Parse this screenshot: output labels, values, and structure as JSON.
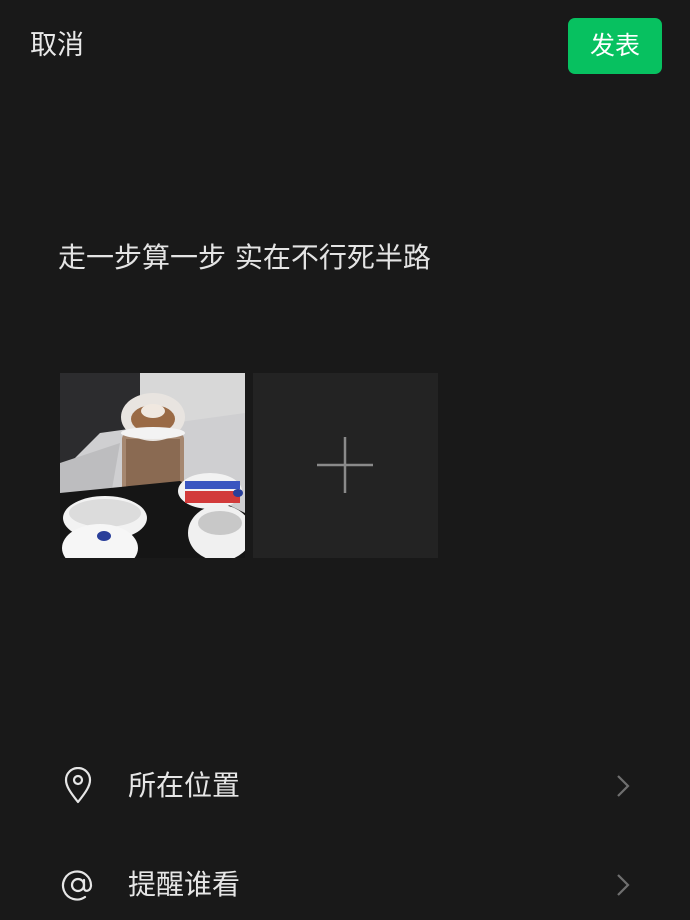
{
  "header": {
    "cancel_label": "取消",
    "publish_label": "发表"
  },
  "post": {
    "text": "走一步算一步 实在不行死半路"
  },
  "attachments": {
    "photo_icon": "photo-thumbnail",
    "add_icon": "plus-icon"
  },
  "options": [
    {
      "label": "所在位置",
      "icon": "location-pin-icon"
    },
    {
      "label": "提醒谁看",
      "icon": "at-sign-icon"
    }
  ],
  "colors": {
    "background": "#191919",
    "accent": "#07c160",
    "text": "#e6e6e6",
    "tile": "#232323"
  }
}
